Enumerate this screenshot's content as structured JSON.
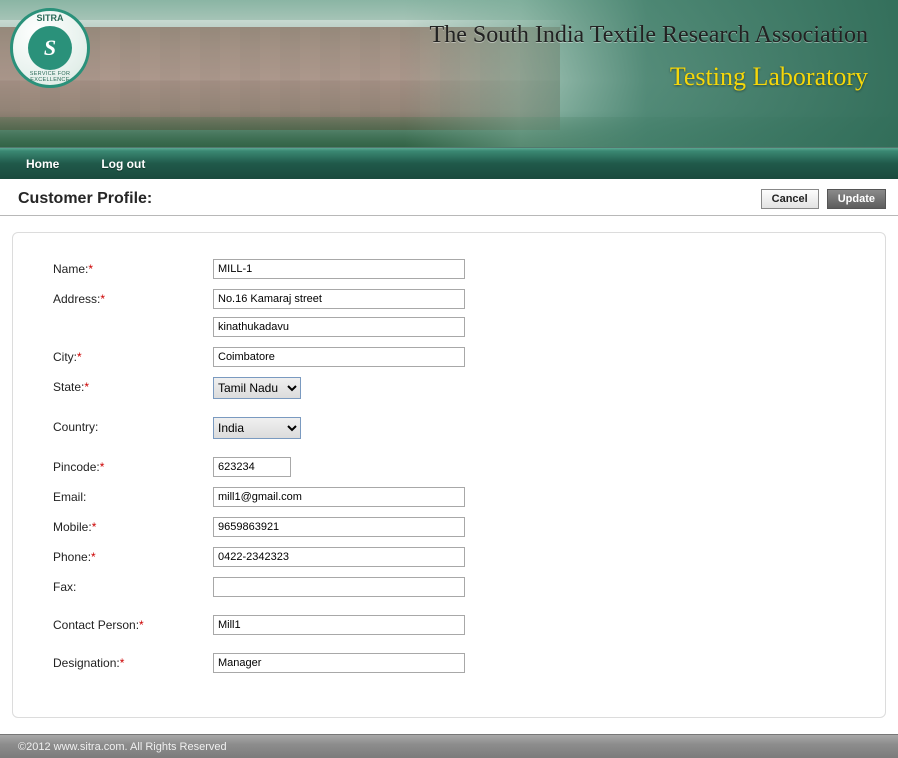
{
  "banner": {
    "logo_top": "SITRA",
    "logo_letter": "S",
    "logo_bottom": "SERVICE FOR EXCELLENCE",
    "title": "The South India Textile Research Association",
    "subtitle": "Testing Laboratory"
  },
  "nav": {
    "home": "Home",
    "logout": "Log out"
  },
  "page": {
    "heading": "Customer Profile:",
    "cancel": "Cancel",
    "update": "Update"
  },
  "form": {
    "labels": {
      "name": "Name:",
      "address": "Address:",
      "city": "City:",
      "state": "State:",
      "country": "Country:",
      "pincode": "Pincode:",
      "email": "Email:",
      "mobile": "Mobile:",
      "phone": "Phone:",
      "fax": "Fax:",
      "contact_person": "Contact Person:",
      "designation": "Designation:"
    },
    "values": {
      "name": "MILL-1",
      "address1": "No.16 Kamaraj street",
      "address2": "kinathukadavu",
      "city": "Coimbatore",
      "state": "Tamil Nadu",
      "country": "India",
      "pincode": "623234",
      "email": "mill1@gmail.com",
      "mobile": "9659863921",
      "phone": "0422-2342323",
      "fax": "",
      "contact_person": "Mill1",
      "designation": "Manager"
    },
    "required": {
      "name": true,
      "address": true,
      "city": true,
      "state": true,
      "pincode": true,
      "mobile": true,
      "phone": true,
      "contact_person": true,
      "designation": true
    },
    "asterisk": "*"
  },
  "footer": {
    "text": "©2012 www.sitra.com. All Rights Reserved"
  }
}
